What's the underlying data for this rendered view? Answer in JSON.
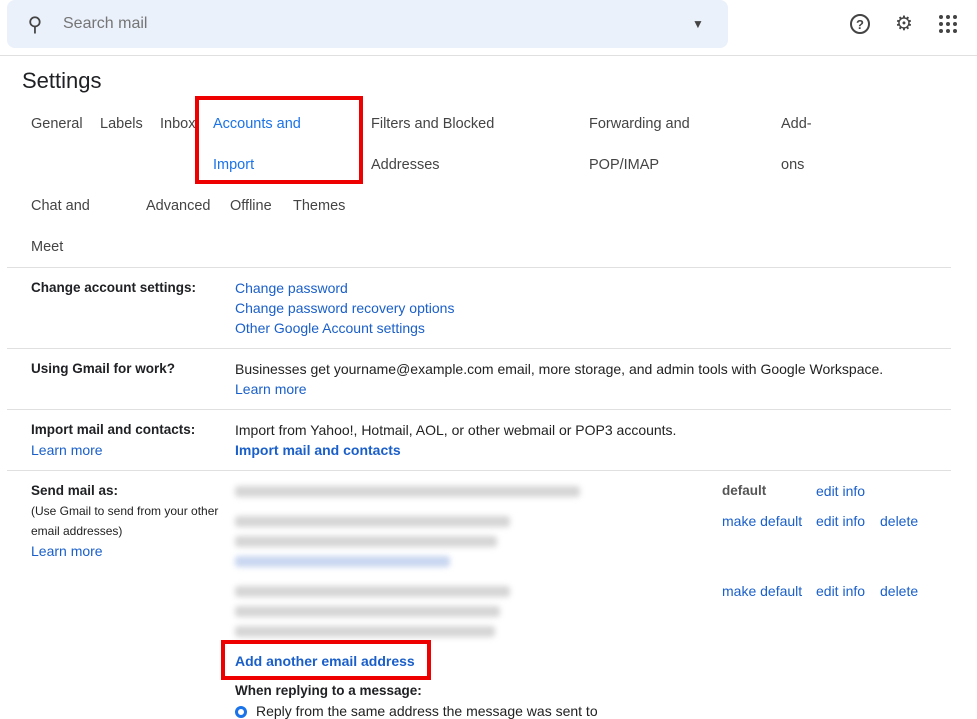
{
  "search": {
    "placeholder": "Search mail"
  },
  "title": "Settings",
  "tabs": [
    {
      "l1": "General"
    },
    {
      "l1": "Labels"
    },
    {
      "l1": "Inbox"
    },
    {
      "l1": "Accounts and",
      "l2": "Import"
    },
    {
      "l1": "Filters and Blocked",
      "l2": "Addresses"
    },
    {
      "l1": "Forwarding and",
      "l2": "POP/IMAP"
    },
    {
      "l1": "Add-",
      "l2": "ons"
    },
    {
      "l1": "Chat and",
      "l2": "Meet"
    },
    {
      "l1": "Advanced"
    },
    {
      "l1": "Offline"
    },
    {
      "l1": "Themes"
    }
  ],
  "accent": "#1a73e8",
  "highlight": "#e00000",
  "sections": {
    "account": {
      "label": "Change account settings:",
      "links": [
        "Change password",
        "Change password recovery options",
        "Other Google Account settings"
      ]
    },
    "work": {
      "label": "Using Gmail for work?",
      "text": "Businesses get yourname@example.com email, more storage, and admin tools with Google Workspace.",
      "link": "Learn more"
    },
    "import": {
      "label": "Import mail and contacts:",
      "learn": "Learn more",
      "text": "Import from Yahoo!, Hotmail, AOL, or other webmail or POP3 accounts.",
      "link": "Import mail and contacts"
    },
    "sendas": {
      "label": "Send mail as:",
      "note1": "(Use Gmail to send from your other",
      "note2": "email addresses)",
      "learn": "Learn more",
      "default": "default",
      "edit": "edit info",
      "make_default": "make default",
      "delete": "delete",
      "add": "Add another email address",
      "reply": "When replying to a message:",
      "reply_opt": "Reply from the same address the message was sent to"
    }
  }
}
